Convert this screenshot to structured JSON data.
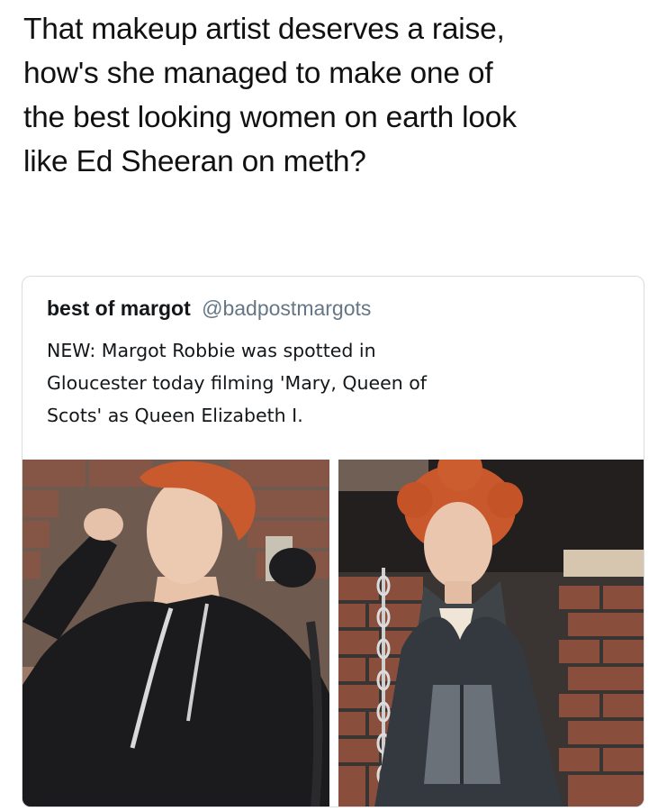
{
  "post": {
    "lines": [
      "That makeup artist deserves a raise,",
      "how's she managed to make one of",
      "the best looking women on earth look",
      "like Ed Sheeran on meth?"
    ]
  },
  "tweet": {
    "display_name": "best of margot",
    "handle": "@badpostmargots",
    "body_lines": [
      "NEW: Margot Robbie was spotted in",
      "Gloucester today filming 'Mary, Queen of",
      "Scots' as Queen Elizabeth I."
    ]
  },
  "media": [
    {
      "icon": "photo-woman-in-black-hoodie"
    },
    {
      "icon": "photo-woman-in-period-costume"
    }
  ],
  "colors": {
    "text": "#111111",
    "handle": "#657786",
    "card_border": "#d8dde2",
    "hair": "#c95a2e",
    "hoodie": "#1b1b1d",
    "brick": "#8a4e3c"
  }
}
